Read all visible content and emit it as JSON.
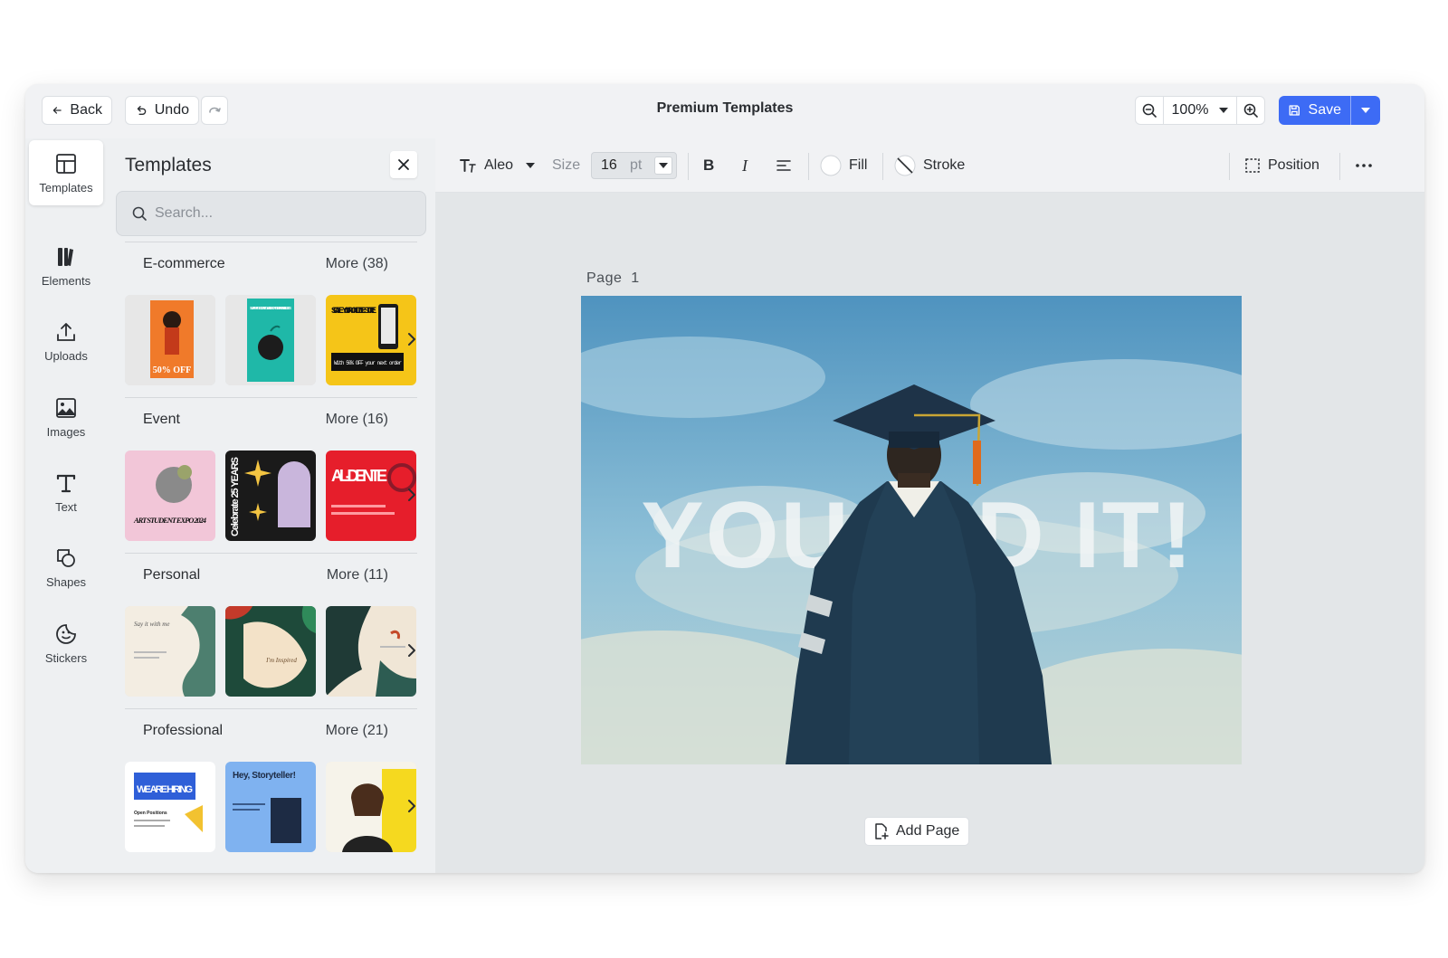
{
  "window": {
    "title": "Premium Templates",
    "back_label": "Back",
    "undo_label": "Undo",
    "zoom_level": "100%",
    "save_label": "Save"
  },
  "rail": {
    "items": [
      {
        "label": "Templates",
        "icon": "templates-icon",
        "active": true
      },
      {
        "label": "Elements",
        "icon": "elements-icon"
      },
      {
        "label": "Uploads",
        "icon": "upload-icon"
      },
      {
        "label": "Images",
        "icon": "image-icon"
      },
      {
        "label": "Text",
        "icon": "text-icon"
      },
      {
        "label": "Shapes",
        "icon": "shapes-icon"
      },
      {
        "label": "Stickers",
        "icon": "sticker-icon"
      }
    ]
  },
  "panel": {
    "title": "Templates",
    "search_placeholder": "Search...",
    "sections": [
      {
        "name": "E-commerce",
        "more": "More (38)",
        "thumbs": [
          {
            "text": "50% OFF",
            "colors": [
              "#f07a2a",
              "#c33a1a"
            ]
          },
          {
            "text": "SUPERFOODS AT YOUR DOORSTEP IN TEN MINUTES",
            "colors": [
              "#1fb8a8",
              "#0d6e62"
            ]
          },
          {
            "text": "SCALE YOUR ONLINE STORE",
            "subtext": "With 50% OFF your next order",
            "colors": [
              "#f5c518",
              "#1b1b1b"
            ]
          }
        ]
      },
      {
        "name": "Event",
        "more": "More (16)",
        "thumbs": [
          {
            "text": "ART STUDENT EXPO 2024",
            "colors": [
              "#f2c6d8",
              "#6b6b6b"
            ]
          },
          {
            "text": "Celebrate 25 YEARS",
            "colors": [
              "#1a1a1a",
              "#f4c542"
            ]
          },
          {
            "text": "AL-DENTE",
            "colors": [
              "#e61e2b",
              "#ffffff"
            ]
          }
        ]
      },
      {
        "name": "Personal",
        "more": "More (11)",
        "thumbs": [
          {
            "text": "Say it with me",
            "colors": [
              "#f3ede2",
              "#2f6b5a"
            ]
          },
          {
            "text": "I'm Inspired",
            "colors": [
              "#f3e2c8",
              "#1e4a3a"
            ]
          },
          {
            "text": "",
            "colors": [
              "#1f3a36",
              "#f0e6d6"
            ]
          }
        ]
      },
      {
        "name": "Professional",
        "more": "More (21)",
        "thumbs": [
          {
            "text": "WE ARE HIRING",
            "subtext": "Open Positions",
            "colors": [
              "#ffffff",
              "#2f5fd8"
            ]
          },
          {
            "text": "Hey, Storyteller!",
            "colors": [
              "#7fb2f0",
              "#1d2b44"
            ]
          },
          {
            "text": "",
            "colors": [
              "#f6f3ea",
              "#f5d91f"
            ]
          }
        ]
      }
    ]
  },
  "toolbar": {
    "font_name": "Aleo",
    "size_label": "Size",
    "size_value": "16",
    "size_unit": "pt",
    "bold_label": "B",
    "italic_label": "I",
    "fill_label": "Fill",
    "stroke_label": "Stroke",
    "position_label": "Position"
  },
  "canvas": {
    "page_label": "Page  1",
    "headline": "YOU DID IT!",
    "add_page_label": "Add Page"
  },
  "colors": {
    "accent": "#3d6bf5",
    "window_bg": "#eef0f2",
    "canvas_bg": "#e3e6e8"
  }
}
